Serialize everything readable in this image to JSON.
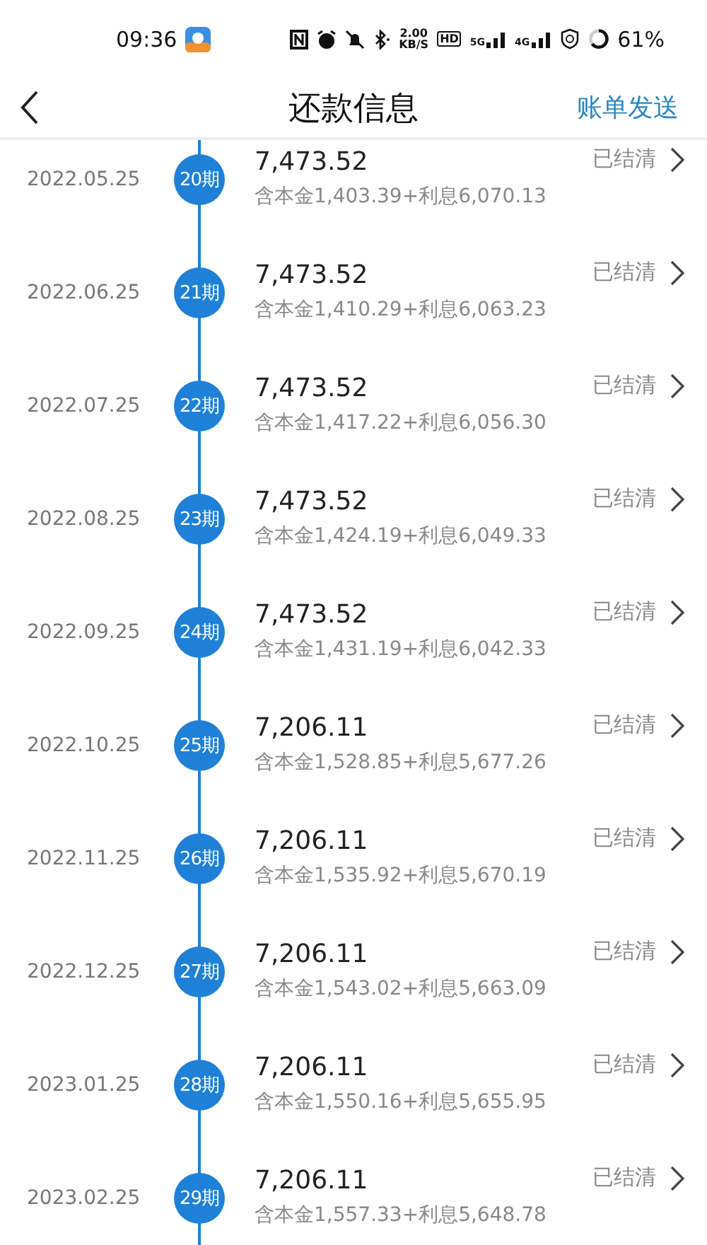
{
  "status_bar": {
    "time": "09:36",
    "net_speed": "2.00",
    "net_unit": "KB/S",
    "hd": "HD",
    "sim1": "5G",
    "sim2": "4G",
    "battery": "61%"
  },
  "header": {
    "title": "还款信息",
    "action": "账单发送"
  },
  "installments": [
    {
      "date": "2022.05.25",
      "period": "20期",
      "amount": "7,473.52",
      "detail": "含本金1,403.39+利息6,070.13",
      "status": "已结清"
    },
    {
      "date": "2022.06.25",
      "period": "21期",
      "amount": "7,473.52",
      "detail": "含本金1,410.29+利息6,063.23",
      "status": "已结清"
    },
    {
      "date": "2022.07.25",
      "period": "22期",
      "amount": "7,473.52",
      "detail": "含本金1,417.22+利息6,056.30",
      "status": "已结清"
    },
    {
      "date": "2022.08.25",
      "period": "23期",
      "amount": "7,473.52",
      "detail": "含本金1,424.19+利息6,049.33",
      "status": "已结清"
    },
    {
      "date": "2022.09.25",
      "period": "24期",
      "amount": "7,473.52",
      "detail": "含本金1,431.19+利息6,042.33",
      "status": "已结清"
    },
    {
      "date": "2022.10.25",
      "period": "25期",
      "amount": "7,206.11",
      "detail": "含本金1,528.85+利息5,677.26",
      "status": "已结清"
    },
    {
      "date": "2022.11.25",
      "period": "26期",
      "amount": "7,206.11",
      "detail": "含本金1,535.92+利息5,670.19",
      "status": "已结清"
    },
    {
      "date": "2022.12.25",
      "period": "27期",
      "amount": "7,206.11",
      "detail": "含本金1,543.02+利息5,663.09",
      "status": "已结清"
    },
    {
      "date": "2023.01.25",
      "period": "28期",
      "amount": "7,206.11",
      "detail": "含本金1,550.16+利息5,655.95",
      "status": "已结清"
    },
    {
      "date": "2023.02.25",
      "period": "29期",
      "amount": "7,206.11",
      "detail": "含本金1,557.33+利息5,648.78",
      "status": "已结清"
    }
  ]
}
